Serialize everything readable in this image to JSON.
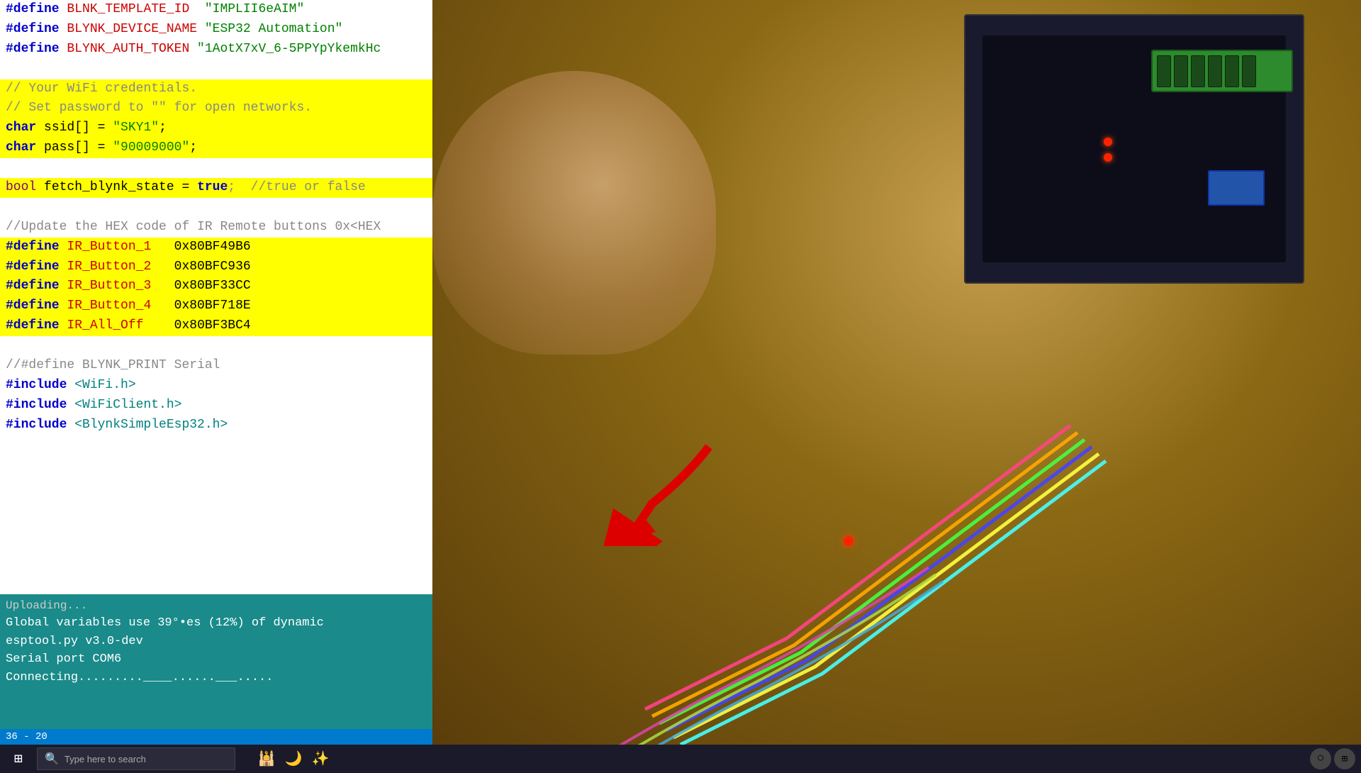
{
  "editor": {
    "lines": [
      {
        "id": "l1",
        "text": "#define BLNK_TEMPLATE_ID  \"IMPLII6eAIM\"",
        "highlight": false,
        "parts": [
          {
            "t": "#define ",
            "c": "kw-blue"
          },
          {
            "t": "BLNK_TEMPLATE_ID",
            "c": "kw-red"
          },
          {
            "t": "  \"IMPLII6eAIM\"",
            "c": "str-green"
          }
        ]
      },
      {
        "id": "l2",
        "text": "#define BLYNK_DEVICE_NAME \"ESP32 Automation\"",
        "highlight": false,
        "parts": [
          {
            "t": "#define ",
            "c": "kw-blue"
          },
          {
            "t": "BLYNK_DEVICE_NAME",
            "c": "kw-red"
          },
          {
            "t": " \"ESP32 Automation\"",
            "c": "str-green"
          }
        ]
      },
      {
        "id": "l3",
        "text": "#define BLYNK_AUTH_TOKEN \"1AotX7xV_6-5PPYpYkemkHc",
        "highlight": false,
        "parts": [
          {
            "t": "#define ",
            "c": "kw-blue"
          },
          {
            "t": "BLYNK_AUTH_TOKEN",
            "c": "kw-red"
          },
          {
            "t": " \"1AotX7xV_6-5PPYpYkemkHc",
            "c": "str-green"
          }
        ]
      },
      {
        "id": "l4",
        "text": "",
        "highlight": false,
        "parts": []
      },
      {
        "id": "l5",
        "text": "// Your WiFi credentials.",
        "highlight": true,
        "parts": [
          {
            "t": "// Your WiFi credentials.",
            "c": "comment"
          }
        ]
      },
      {
        "id": "l6",
        "text": "// Set password to \"\" for open networks.",
        "highlight": true,
        "parts": [
          {
            "t": "// Set password to \"\" for open networks.",
            "c": "comment"
          }
        ]
      },
      {
        "id": "l7",
        "text": "char ssid[] = \"SKY1\";",
        "highlight": true,
        "parts": [
          {
            "t": "char ",
            "c": "kw-blue"
          },
          {
            "t": "ssid",
            "c": "plain"
          },
          {
            "t": "[] = ",
            "c": "plain"
          },
          {
            "t": "\"SKY1\"",
            "c": "str-green"
          },
          {
            "t": ";",
            "c": "plain"
          }
        ]
      },
      {
        "id": "l8",
        "text": "char pass[] = \"90009000\";",
        "highlight": true,
        "parts": [
          {
            "t": "char ",
            "c": "kw-blue"
          },
          {
            "t": "pass",
            "c": "plain"
          },
          {
            "t": "[] = ",
            "c": "plain"
          },
          {
            "t": "\"90009000\"",
            "c": "str-green"
          },
          {
            "t": ";",
            "c": "plain"
          }
        ]
      },
      {
        "id": "l9",
        "text": "",
        "highlight": false,
        "parts": []
      },
      {
        "id": "l10",
        "text": "bool fetch_blynk_state = true;  //true or false",
        "highlight": true,
        "parts": [
          {
            "t": "bool ",
            "c": "kw-purple"
          },
          {
            "t": "fetch_blynk_state",
            "c": "plain"
          },
          {
            "t": " = ",
            "c": "plain"
          },
          {
            "t": "true",
            "c": "kw-blue"
          },
          {
            "t": ";  //true or false",
            "c": "comment"
          }
        ]
      },
      {
        "id": "l11",
        "text": "",
        "highlight": false,
        "parts": []
      },
      {
        "id": "l12",
        "text": "//Update the HEX code of IR Remote buttons 0x<HEX",
        "highlight": false,
        "parts": [
          {
            "t": "//Update the HEX code of IR Remote buttons 0x<HEX",
            "c": "comment"
          }
        ]
      },
      {
        "id": "l13",
        "text": "#define IR_Button_1   0x80BF49B6",
        "highlight": true,
        "parts": [
          {
            "t": "#define ",
            "c": "kw-blue"
          },
          {
            "t": "IR_Button_1",
            "c": "kw-red"
          },
          {
            "t": "   0x80BF49B6",
            "c": "plain"
          }
        ]
      },
      {
        "id": "l14",
        "text": "#define IR_Button_2   0x80BFC936",
        "highlight": true,
        "parts": [
          {
            "t": "#define ",
            "c": "kw-blue"
          },
          {
            "t": "IR_Button_2",
            "c": "kw-red"
          },
          {
            "t": "   0x80BFC936",
            "c": "plain"
          }
        ]
      },
      {
        "id": "l15",
        "text": "#define IR_Button_3   0x80BF33CC",
        "highlight": true,
        "parts": [
          {
            "t": "#define ",
            "c": "kw-blue"
          },
          {
            "t": "IR_Button_3",
            "c": "kw-red"
          },
          {
            "t": "   0x80BF33CC",
            "c": "plain"
          }
        ]
      },
      {
        "id": "l16",
        "text": "#define IR_Button_4   0x80BF718E",
        "highlight": true,
        "parts": [
          {
            "t": "#define ",
            "c": "kw-blue"
          },
          {
            "t": "IR_Button_4",
            "c": "kw-red"
          },
          {
            "t": "   0x80BF718E",
            "c": "plain"
          }
        ]
      },
      {
        "id": "l17",
        "text": "#define IR_All_Off    0x80BF3BC4",
        "highlight": true,
        "parts": [
          {
            "t": "#define ",
            "c": "kw-blue"
          },
          {
            "t": "IR_All_Off",
            "c": "kw-red"
          },
          {
            "t": "    0x80BF3BC4",
            "c": "plain"
          }
        ]
      },
      {
        "id": "l18",
        "text": "",
        "highlight": false,
        "parts": []
      },
      {
        "id": "l19",
        "text": "//#define BLYNK_PRINT Serial",
        "highlight": false,
        "parts": [
          {
            "t": "//#define BLYNK_PRINT Serial",
            "c": "comment"
          }
        ]
      },
      {
        "id": "l20",
        "text": "#include <WiFi.h>",
        "highlight": false,
        "parts": [
          {
            "t": "#include ",
            "c": "kw-blue"
          },
          {
            "t": "<WiFi.h>",
            "c": "kw-teal"
          }
        ]
      },
      {
        "id": "l21",
        "text": "#include <WiFiClient.h>",
        "highlight": false,
        "parts": [
          {
            "t": "#include ",
            "c": "kw-blue"
          },
          {
            "t": "<WiFiClient.h>",
            "c": "kw-teal"
          }
        ]
      },
      {
        "id": "l22",
        "text": "#include <BlynkSimpleEsp32.h>",
        "highlight": false,
        "parts": [
          {
            "t": "#include ",
            "c": "kw-blue"
          },
          {
            "t": "<BlynkSimpleEsp32.h>",
            "c": "kw-teal"
          }
        ]
      }
    ]
  },
  "console": {
    "uploading_label": "Uploading...",
    "lines": [
      "Global variables use 39°•es (12%) of dynamic",
      "esptool.py v3.0-dev",
      "Serial port COM6",
      "Connecting.........____......___....."
    ]
  },
  "status_bar": {
    "position": "36 - 20"
  },
  "taskbar": {
    "search_placeholder": "Type here to search",
    "windows_icon": "⊞"
  },
  "colors": {
    "highlight_yellow": "#ffff00",
    "console_teal": "#1a8a8a",
    "keyword_blue": "#0000cc",
    "keyword_red": "#cc0000",
    "string_green": "#008000",
    "comment_gray": "#888888"
  }
}
